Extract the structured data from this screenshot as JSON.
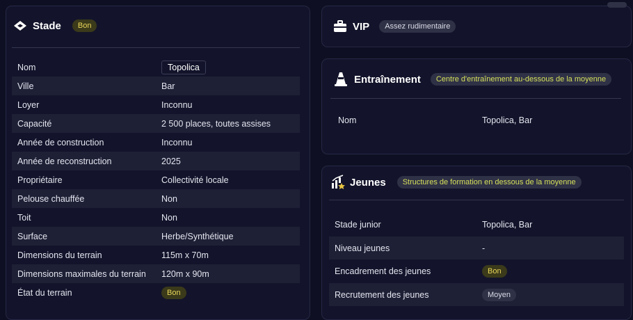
{
  "stade": {
    "title": "Stade",
    "badge": "Bon",
    "rows": [
      {
        "label": "Nom",
        "value": "Topolica"
      },
      {
        "label": "Ville",
        "value": "Bar"
      },
      {
        "label": "Loyer",
        "value": "Inconnu"
      },
      {
        "label": "Capacité",
        "value": "2 500 places, toutes assises"
      },
      {
        "label": "Année de construction",
        "value": "Inconnu"
      },
      {
        "label": "Année de reconstruction",
        "value": "2025"
      },
      {
        "label": "Propriétaire",
        "value": "Collectivité locale"
      },
      {
        "label": "Pelouse chauffée",
        "value": "Non"
      },
      {
        "label": "Toit",
        "value": "Non"
      },
      {
        "label": "Surface",
        "value": "Herbe/Synthétique"
      },
      {
        "label": "Dimensions du terrain",
        "value": "115m x 70m"
      },
      {
        "label": "Dimensions maximales du terrain",
        "value": "120m x 90m"
      },
      {
        "label": "État du terrain",
        "value": "Bon"
      }
    ]
  },
  "vip": {
    "title": "VIP",
    "badge": "Assez rudimentaire"
  },
  "entrainement": {
    "title": "Entraînement",
    "badge": "Centre d'entraînement au-dessous de la moyenne",
    "rows": [
      {
        "label": "Nom",
        "value": "Topolica, Bar"
      }
    ]
  },
  "jeunes": {
    "title": "Jeunes",
    "badge": "Structures de formation en dessous de la moyenne",
    "rows": [
      {
        "label": "Stade junior",
        "value": "Topolica, Bar"
      },
      {
        "label": "Niveau jeunes",
        "value": "-"
      },
      {
        "label": "Encadrement des jeunes",
        "value": "Bon"
      },
      {
        "label": "Recrutement des jeunes",
        "value": "Moyen"
      }
    ]
  },
  "icons": {
    "stade": "stadium-icon",
    "vip": "briefcase-icon",
    "entrainement": "cone-icon",
    "jeunes": "youth-chart-star-icon"
  },
  "colors": {
    "background": "#0e0f22",
    "card": "#13142b",
    "row_alt": "#1e2036",
    "badge_good_bg": "#3b3a1a",
    "badge_good_text": "#e8d65a",
    "badge_warn_text": "#d6e05a"
  }
}
